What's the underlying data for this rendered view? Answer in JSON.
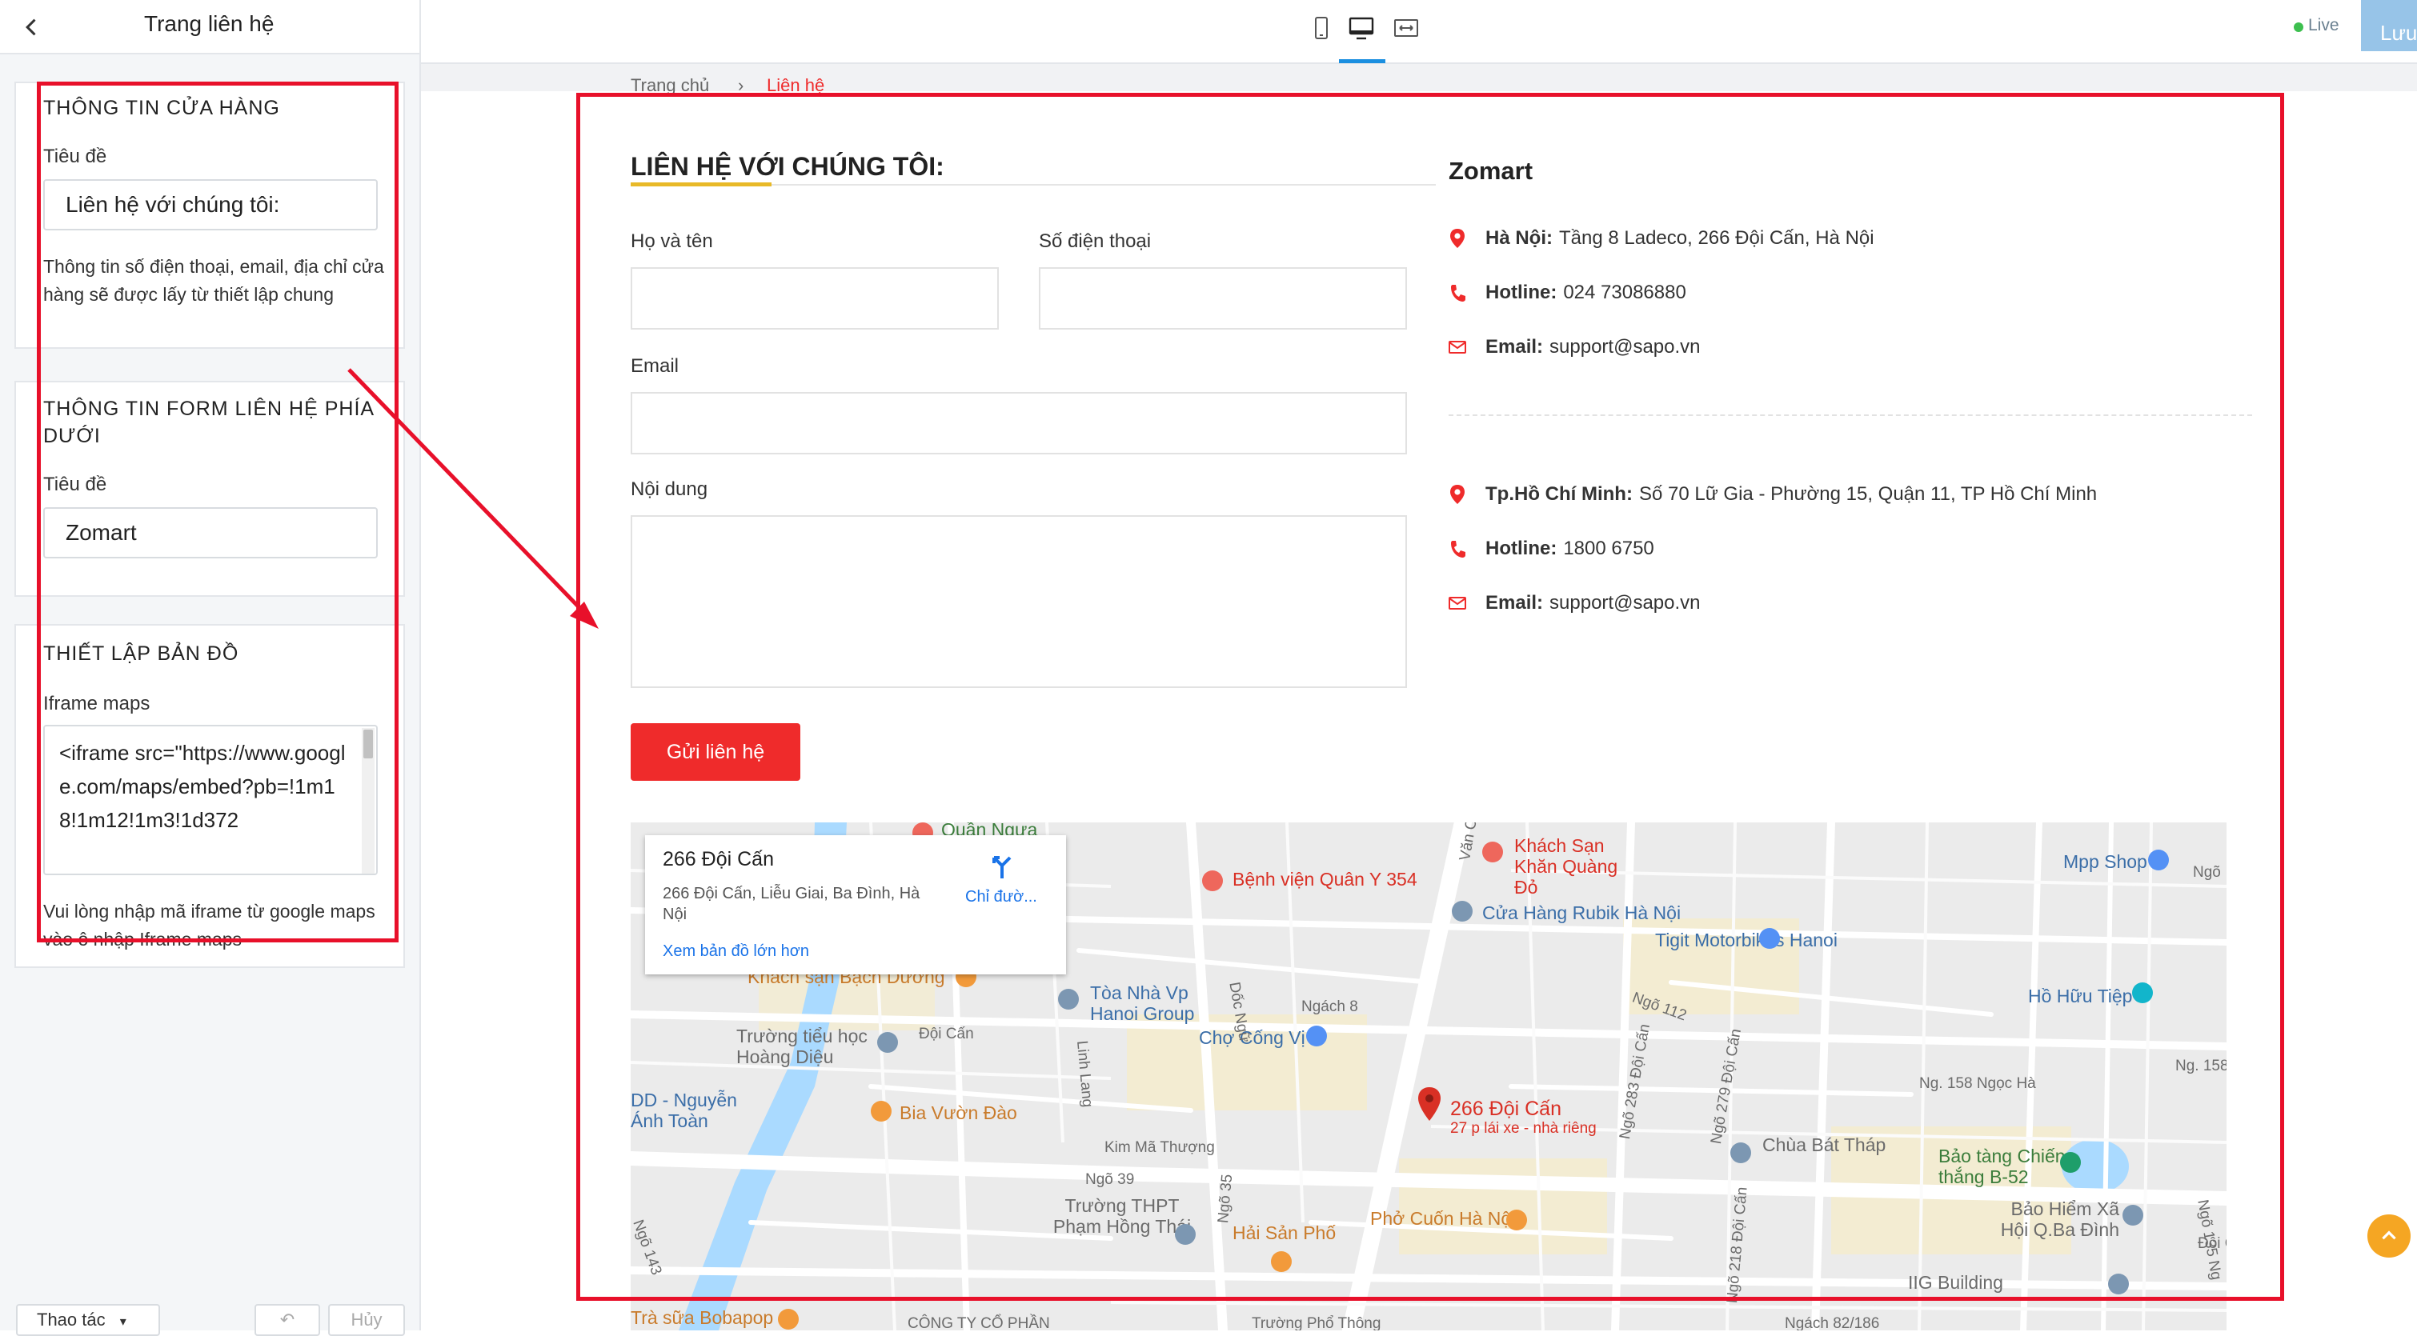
{
  "sidebar": {
    "title": "Trang liên hệ",
    "store_info": {
      "heading": "THÔNG TIN CỬA HÀNG",
      "title_label": "Tiêu đề",
      "title_value": "Liên hệ với chúng tôi:",
      "help": "Thông tin số điện thoại, email, địa chỉ cửa hàng sẽ được lấy từ thiết lập chung"
    },
    "form_info": {
      "heading": "THÔNG TIN FORM LIÊN HỆ PHÍA DƯỚI",
      "title_label": "Tiêu đề",
      "title_value": "Zomart"
    },
    "map_setup": {
      "heading": "THIẾT LẬP BẢN ĐỒ",
      "iframe_label": "Iframe maps",
      "iframe_value": "<iframe src=\"https://www.google.com/maps/embed?pb=!1m18!1m12!1m3!1d372",
      "help": "Vui lòng nhập mã iframe từ google maps vào ô nhập Iframe maps"
    },
    "bottom": {
      "actions_label": "Thao tác",
      "undo_label": "Hủy"
    }
  },
  "topbar": {
    "live_label": "Live",
    "save_label": "Lưu"
  },
  "preview": {
    "breadcrumb": {
      "home": "Trang chủ",
      "sep": "›",
      "current": "Liên hệ"
    },
    "contact_title": "LIÊN HỆ VỚI CHÚNG TÔI:",
    "form": {
      "name_label": "Họ và tên",
      "phone_label": "Số điện thoại",
      "email_label": "Email",
      "content_label": "Nội dung",
      "submit_label": "Gửi liên hệ"
    },
    "store_name": "Zomart",
    "branches": [
      {
        "city": "Hà Nội:",
        "address": "Tầng 8 Ladeco, 266 Đội Cấn, Hà Nội",
        "hotline_label": "Hotline:",
        "hotline": "024 73086880",
        "email_label": "Email:",
        "email": "support@sapo.vn"
      },
      {
        "city": "Tp.Hồ Chí Minh:",
        "address": "Số 70 Lữ Gia - Phường 15, Quận 11, TP Hồ Chí Minh",
        "hotline_label": "Hotline:",
        "hotline": "1800 6750",
        "email_label": "Email:",
        "email": "support@sapo.vn"
      }
    ],
    "map": {
      "card_title": "266 Đội Cấn",
      "card_address": "266 Đội Cấn, Liễu Giai, Ba Đình, Hà Nội",
      "card_directions": "Chỉ đườ...",
      "card_link": "Xem bản đồ lớn hơn",
      "pin_label": "266 Đội Cấn",
      "pin_sub": "27 p lái xe - nhà riêng",
      "places": {
        "quan_ngua": "Quần Ngựa",
        "benh_vien": "Bệnh viện Quân Y 354",
        "khach_san_khan": "Khách Sạn Khăn Quàng Đỏ",
        "mpp_shop": "Mpp Shop",
        "rubik": "Cửa Hàng Rubik Hà Nội",
        "tigit": "Tigit Motorbikes Hanoi",
        "bach_duong": "Khách sạn Bạch Dương",
        "toa_nha": "Tòa Nhà Vp Hanoi Group",
        "ho_huu_tiep": "Hồ Hữu Tiệp",
        "tieu_hoc": "Trường tiểu học Hoàng Diệu",
        "cho_cong_vi": "Chợ Cống Vị",
        "dd_nguyen": "DD - Nguyễn Ánh Toàn",
        "bia_vuon_dao": "Bia Vườn Đào",
        "chua_bat_thap": "Chùa Bát Tháp",
        "bao_tang": "Bảo tàng Chiến thắng B-52",
        "thpt": "Trường THPT Phạm Hồng Thái",
        "hai_san": "Hải Sản Phố",
        "pho_cuon": "Phở Cuốn Hà Nội",
        "bao_hiem": "Bảo Hiểm Xã Hội Q.Ba Đình",
        "iig": "IIG Building",
        "bobapop": "Trà sữa Bobapop",
        "cong_ty": "CÔNG TY CỔ PHẦN",
        "truong_pho_thong": "Trường Phổ Thông"
      },
      "streets": {
        "ngach8": "Ngách 8",
        "ngo112": "Ngõ 112",
        "doi_can": "Đội Cấn",
        "ngo158": "Ng. 158",
        "ngo158nh": "Ng. 158 Ngọc Hà",
        "kim_ma": "Kim Mã Thượng",
        "ngo39": "Ngõ 39",
        "ngach82": "Ngách 82/186",
        "ngo283": "Ngõ 283 Đội Cấn",
        "ngo279": "Ngõ 279 Đội Cấn",
        "ngo218": "Ngõ 218 Đội Cấn",
        "van_cao": "Văn C",
        "doc_ngu": "Dốc Ngữ",
        "linh_lang": "Linh Lang",
        "ngo143": "Ngõ 143",
        "ngo35": "Ngõ 35",
        "ngo135": "Ngõ 135 Ng",
        "ngo_top": "Ngõ",
        "doi_can_r": "Đội Cấn"
      }
    }
  },
  "colors": {
    "accent_red": "#ef2b2b",
    "annotation_red": "#e8102a",
    "title_underline": "#e8b928",
    "live_green": "#3dbf4f",
    "save_blue": "#97c4e8",
    "device_active": "#1b8fe0"
  },
  "icons": {
    "back": "chevron-left-icon",
    "mobile": "mobile-device-icon",
    "desktop": "desktop-device-icon",
    "fullwidth": "fullwidth-icon",
    "location": "map-marker-icon",
    "phone": "phone-icon",
    "email": "envelope-icon",
    "directions": "directions-icon",
    "scroll_top": "arrow-up-icon"
  }
}
